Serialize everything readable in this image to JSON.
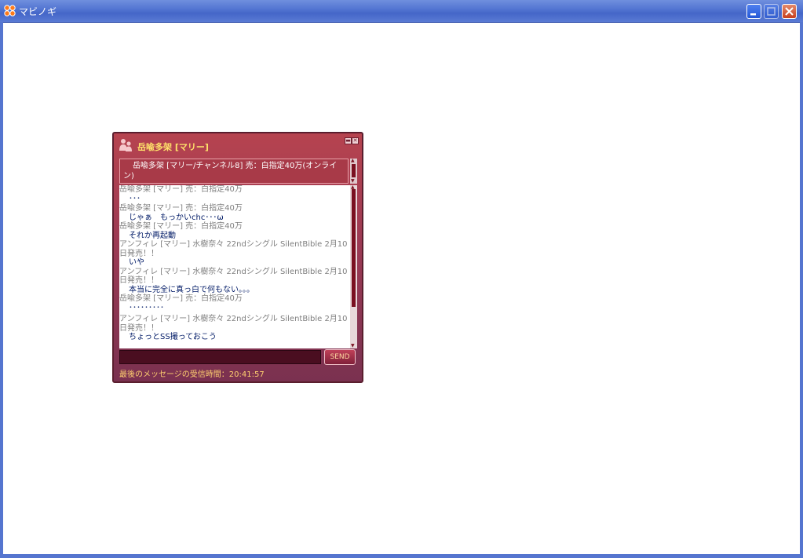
{
  "window": {
    "title": "マビノギ"
  },
  "chat": {
    "title": "岳喩多架 [マリー]",
    "status_line1": "岳喩多架 [マリー/チャンネル8] 売：白指定40万(オンライ",
    "status_line2": "ン)",
    "messages": [
      {
        "head": "岳喩多架 [マリー] 売：白指定40万",
        "body": "･･･"
      },
      {
        "head": "岳喩多架 [マリー] 売：白指定40万",
        "body": "じゃぁ　もっかいchc･･･ω"
      },
      {
        "head": "岳喩多架 [マリー] 売：白指定40万",
        "body": "それか再起動"
      },
      {
        "head": "アンフィレ [マリー] 水樹奈々 22ndシングル SilentBible 2月10日発売！！",
        "body": "いや"
      },
      {
        "head": "アンフィレ [マリー] 水樹奈々 22ndシングル SilentBible 2月10日発売！！",
        "body": "本当に完全に真っ白で何もない。。。"
      },
      {
        "head": "岳喩多架 [マリー] 売：白指定40万",
        "body": "･････････"
      },
      {
        "head": "アンフィレ [マリー] 水樹奈々 22ndシングル SilentBible 2月10日発売！！",
        "body": "ちょっとSS撮っておこう"
      }
    ],
    "send_label": "SEND",
    "footer": "最後のメッセージの受信時間：20:41:57"
  },
  "colors": {
    "title_text": "#ffe36a",
    "chat_bg": "#9c3a54",
    "message_body": "#001a66",
    "message_head": "#7f7f7f"
  }
}
